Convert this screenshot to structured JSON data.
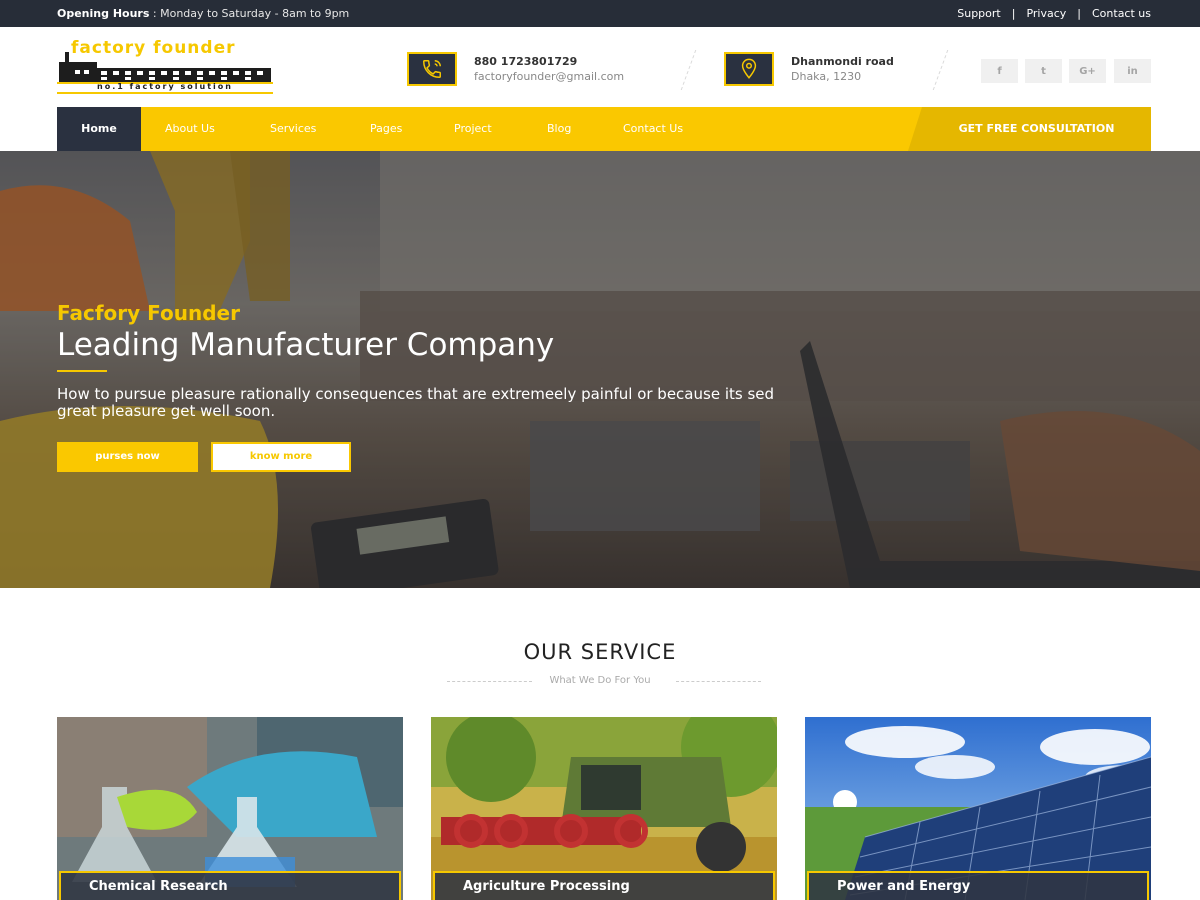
{
  "topbar": {
    "hours_label": "Opening Hours",
    "hours_sep": " : ",
    "hours_value": "Monday to Saturday - 8am to 9pm",
    "links": [
      "Support",
      "Privacy",
      "Contact us"
    ]
  },
  "header": {
    "logo_text": "factory founder",
    "logo_tagline": "no.1 factory solution",
    "phone": "880 1723801729",
    "email": "factoryfounder@gmail.com",
    "address_line1": "Dhanmondi road",
    "address_line2": "Dhaka, 1230",
    "social": [
      {
        "icon": "facebook-icon",
        "glyph": "f"
      },
      {
        "icon": "twitter-icon",
        "glyph": "t"
      },
      {
        "icon": "google-plus-icon",
        "glyph": "G+"
      },
      {
        "icon": "linkedin-icon",
        "glyph": "in"
      }
    ]
  },
  "nav": {
    "items": [
      "Home",
      "About Us",
      "Services",
      "Pages",
      "Project",
      "Blog",
      "Contact Us"
    ],
    "active": "Home",
    "cta": "GET FREE CONSULTATION"
  },
  "hero": {
    "subtitle": "Facfory Founder",
    "title": "Leading Manufacturer Company",
    "description": "How to pursue pleasure rationally consequences that are extremeely painful or because its sed great pleasure get well soon.",
    "btn_primary": "purses now",
    "btn_secondary": "know more"
  },
  "services": {
    "title": "OUR SERVICE",
    "subtitle": "What We Do For You",
    "cards": [
      "Chemical Research",
      "Agriculture Processing",
      "Power and Energy"
    ]
  },
  "colors": {
    "accent": "#fac800",
    "dark": "#272d38",
    "nav_dark": "#2a3140"
  }
}
